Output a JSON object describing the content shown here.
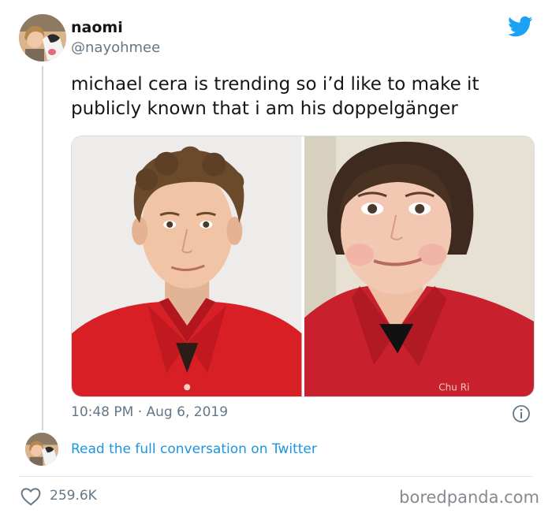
{
  "author": {
    "display_name": "naomi",
    "handle": "@nayohmee",
    "avatar_icon": "profile-photo-with-dog"
  },
  "tweet": {
    "text": "michael cera is trending so i’d like to make it publicly known that i am his doppelgänger",
    "timestamp": "10:48 PM · Aug 6, 2019",
    "photos": [
      "photo-curly-haired-man-red-polo",
      "photo-woman-red-polo"
    ]
  },
  "footer": {
    "conversation_link": "Read the full conversation on Twitter",
    "like_count": "259.6K",
    "watermark": "boredpanda.com"
  },
  "colors": {
    "twitter_blue": "#1da1f2",
    "link_blue": "#1b95e0",
    "secondary_text": "#657786",
    "shirt_red": "#d81f26"
  },
  "icons": {
    "brand": "twitter-bird-icon",
    "info": "info-icon",
    "like": "heart-icon"
  }
}
